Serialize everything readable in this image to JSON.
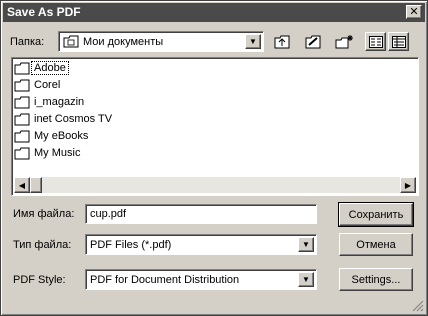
{
  "window": {
    "title": "Save As PDF",
    "close_glyph": "✕"
  },
  "location": {
    "label": "Папка:",
    "value": "Мои документы"
  },
  "toolbar": {
    "icons": [
      "up-folder-icon",
      "create-folder-icon",
      "new-folder-icon",
      "list-view-icon",
      "details-view-icon"
    ]
  },
  "files": [
    {
      "name": "Adobe",
      "selected": true
    },
    {
      "name": "Corel"
    },
    {
      "name": "i_magazin"
    },
    {
      "name": "inet Cosmos TV"
    },
    {
      "name": "My eBooks"
    },
    {
      "name": "My Music"
    }
  ],
  "filename": {
    "label": "Имя файла:",
    "value": "cup.pdf"
  },
  "filetype": {
    "label": "Тип файла:",
    "value": "PDF Files (*.pdf)"
  },
  "pdfstyle": {
    "label": "PDF Style:",
    "value": "PDF for Document Distribution"
  },
  "buttons": {
    "save": "Сохранить",
    "cancel": "Отмена",
    "settings": "Settings..."
  },
  "colors": {
    "titlebar": "#4a4a4a",
    "face": "#d4d0c8"
  }
}
